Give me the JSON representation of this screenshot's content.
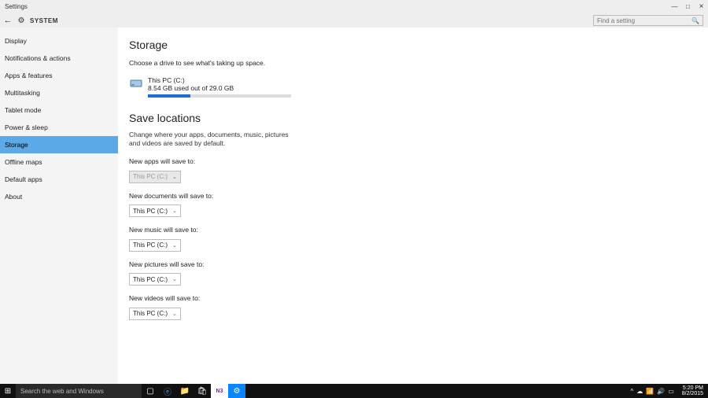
{
  "window": {
    "title": "Settings"
  },
  "header": {
    "section": "SYSTEM",
    "search_placeholder": "Find a setting"
  },
  "sidebar": {
    "items": [
      {
        "label": "Display"
      },
      {
        "label": "Notifications & actions"
      },
      {
        "label": "Apps & features"
      },
      {
        "label": "Multitasking"
      },
      {
        "label": "Tablet mode"
      },
      {
        "label": "Power & sleep"
      },
      {
        "label": "Storage",
        "selected": true
      },
      {
        "label": "Offline maps"
      },
      {
        "label": "Default apps"
      },
      {
        "label": "About"
      }
    ]
  },
  "storage": {
    "heading": "Storage",
    "subtitle": "Choose a drive to see what's taking up space.",
    "drive": {
      "name": "This PC (C:)",
      "usage_text": "8.54 GB used out of 29.0 GB",
      "used_gb": 8.54,
      "total_gb": 29.0,
      "fill_pct": 29.4
    }
  },
  "save_locations": {
    "heading": "Save locations",
    "description": "Change where your apps, documents, music, pictures and videos are saved by default.",
    "rows": [
      {
        "label": "New apps will save to:",
        "value": "This PC (C:)",
        "disabled": true
      },
      {
        "label": "New documents will save to:",
        "value": "This PC (C:)",
        "disabled": false
      },
      {
        "label": "New music will save to:",
        "value": "This PC (C:)",
        "disabled": false
      },
      {
        "label": "New pictures will save to:",
        "value": "This PC (C:)",
        "disabled": false
      },
      {
        "label": "New videos will save to:",
        "value": "This PC (C:)",
        "disabled": false
      }
    ]
  },
  "taskbar": {
    "search_placeholder": "Search the web and Windows",
    "time": "5:20 PM",
    "date": "8/2/2015"
  }
}
